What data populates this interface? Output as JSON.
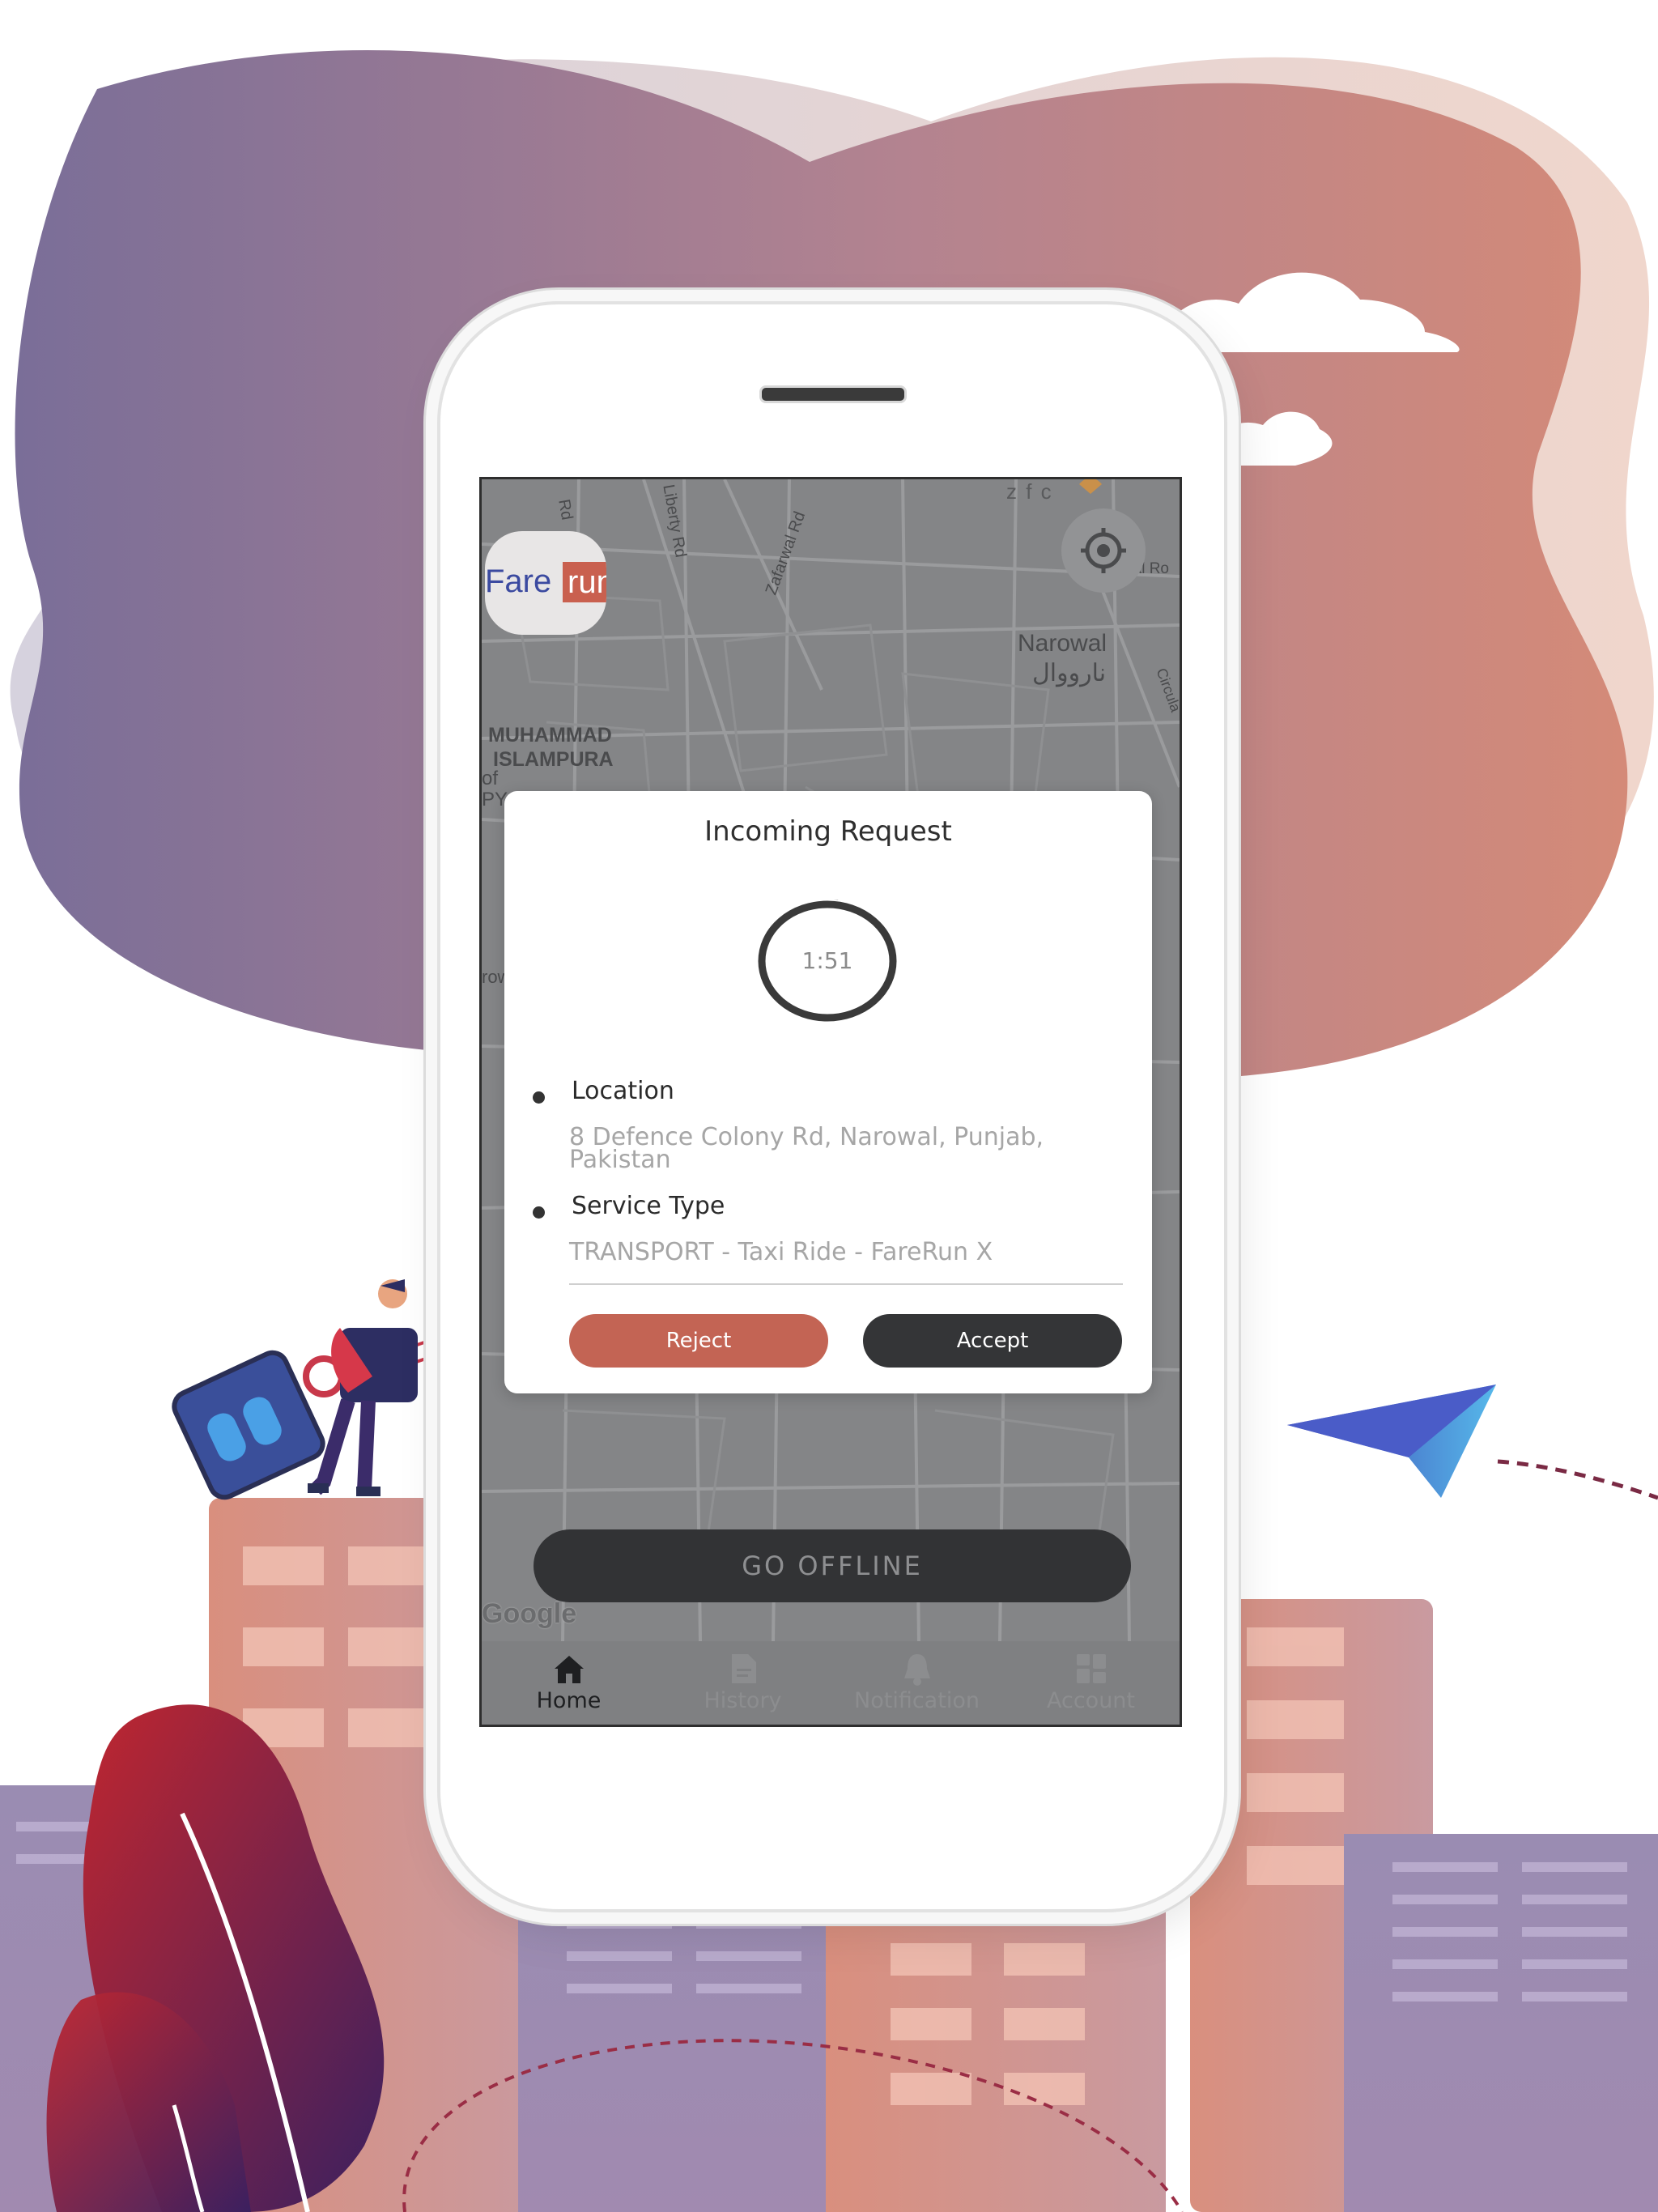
{
  "map": {
    "labels": {
      "liberty_rd": "Liberty Rd",
      "zafarwal_rd": "Zafarwal Rd",
      "rd_top": "Rd",
      "zfc": "z f c",
      "local_rd": "Local Ro",
      "narowal_en": "Narowal",
      "narowal_ur": "نارووال",
      "circular": "Circula",
      "muhammad": "MUHAMMAD",
      "islampura": "ISLAMPURA",
      "of": "of",
      "py": "PY",
      "row": "row"
    },
    "google": "Google"
  },
  "logo": {
    "fare": "Fare",
    "run": "run"
  },
  "modal": {
    "title": "Incoming Request",
    "timer": "1:51",
    "timer_remaining": 0.97,
    "location_label": "Location",
    "location_value": "8 Defence Colony Rd, Narowal, Punjab, Pakistan",
    "service_label": "Service Type",
    "service_value": "TRANSPORT - Taxi Ride - FareRun X",
    "reject_label": "Reject",
    "accept_label": "Accept"
  },
  "go_offline_label": "GO OFFLINE",
  "tabs": [
    {
      "label": "Home",
      "icon": "home-icon",
      "active": true
    },
    {
      "label": "History",
      "icon": "history-icon",
      "active": false
    },
    {
      "label": "Notification",
      "icon": "bell-icon",
      "active": false
    },
    {
      "label": "Account",
      "icon": "grid-icon",
      "active": false
    }
  ],
  "colors": {
    "accent": "#c36454",
    "dark": "#343537",
    "brand_blue": "#3b4aa0"
  }
}
